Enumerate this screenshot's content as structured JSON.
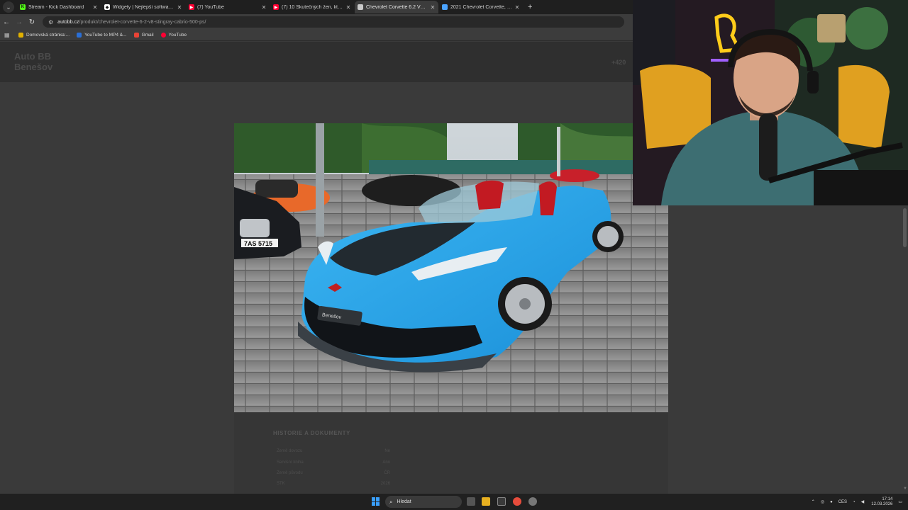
{
  "browser": {
    "tabs": [
      {
        "label": "Stream - Kick Dashboard",
        "icon": "kick-icon",
        "color": "#53fc18",
        "active": false
      },
      {
        "label": "Widgety | Nejlepší software pro",
        "icon": "widgety-icon",
        "color": "#ffffff",
        "active": false
      },
      {
        "label": "(7) YouTube",
        "icon": "youtube-icon",
        "color": "#ff0033",
        "active": false
      },
      {
        "label": "(7) 10 Skutečných žen, které je",
        "icon": "youtube-icon",
        "color": "#ff0033",
        "active": false
      },
      {
        "label": "Chevrolet Corvette 6.2 V8 Sting",
        "icon": "page-icon",
        "color": "#c8c8c8",
        "active": true
      },
      {
        "label": "2021 Chevrolet Corvette, Sting",
        "icon": "page-icon",
        "color": "#4aa3ff",
        "active": false
      }
    ],
    "new_tab": "+",
    "url_host": "autobb.cz",
    "url_path": "/produkt/chevrolet-corvette-6-2-v8-stingray-cabrio-500-ps/",
    "bookmarks": [
      {
        "label": "Domovská stránka:...",
        "color": "#e0b000"
      },
      {
        "label": "YouTube to MP4 &...",
        "color": "#2a6fd6"
      },
      {
        "label": "Gmail",
        "color": "#ea4335"
      },
      {
        "label": "YouTube",
        "color": "#ff0033"
      }
    ]
  },
  "site": {
    "logo_line1": "Auto BB",
    "logo_line2": "Benešov",
    "phone": "+420",
    "section_title": "HISTORIE A DOKUMENTY",
    "spec_rows": [
      {
        "label": "Země dovozu",
        "value": "Ne"
      },
      {
        "label": "Servisní kniha",
        "value": "Ano"
      },
      {
        "label": "Země původu",
        "value": "ČR"
      },
      {
        "label": "STK",
        "value": "2026"
      }
    ],
    "plate_text": "7AS 5715",
    "dealer_plate": "Benešov"
  },
  "taskbar": {
    "search_placeholder": "Hledat",
    "language": "CES",
    "time": "17:14",
    "date": "12.03.2026"
  }
}
